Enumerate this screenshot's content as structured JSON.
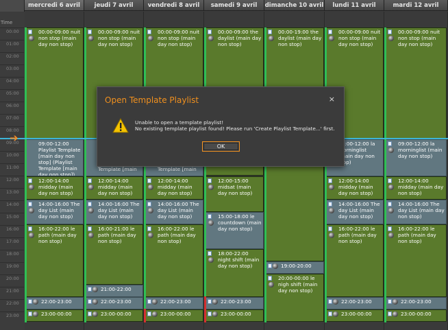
{
  "time_column": {
    "label": "Time",
    "hours": [
      "00:00",
      "01:00",
      "02:00",
      "03:00",
      "04:00",
      "05:00",
      "06:00",
      "07:00",
      "08:00",
      "09:00",
      "10:00",
      "11:00",
      "12:00",
      "13:00",
      "14:00",
      "15:00",
      "16:00",
      "17:00",
      "18:00",
      "19:00",
      "20:00",
      "21:00",
      "22:00",
      "23:00"
    ]
  },
  "days": [
    "mercredi 6 avril",
    "jeudi 7 avril",
    "vendredi 8 avril",
    "samedi 9 avril",
    "dimanche 10 avril",
    "lundi 11 avril",
    "mardi 12 avril"
  ],
  "events": {
    "e0_0": "00:00-09:00 nuit non stop (main day non stop)",
    "e0_1": "09:00-12:00 Playlist Template [main day non stop] (Playlist Template [main day non stop])",
    "e0_2": "12:00-14:00 midday (main day non stop)",
    "e0_3": "14:00-16:00 The day List (main day non stop)",
    "e0_4": "16:00-22:00 le path (main day non stop)",
    "e0_5": "22:00-23:00",
    "e0_6": "23:00-00:00",
    "e1_0": "00:00-09:00 nuit non stop (main day non stop)",
    "e1_1": "Template [main",
    "e1_2": "12:00-14:00 midday (main day non stop)",
    "e1_3": "14:00-16:00 The day List (main day non stop)",
    "e1_4": "16:00-21:00 le path (main day non stop)",
    "e1_5": "21:00-22:00",
    "e1_6": "22:00-23:00",
    "e1_7": "23:00-00:00",
    "e2_0": "00:00-09:00 nuit non stop (main day non stop)",
    "e2_1": "Template [main",
    "e2_2": "12:00-14:00 midday (main day non stop)",
    "e2_3": "14:00-16:00 The day List (main day non stop)",
    "e2_4": "16:00-22:00 le path (main day non stop)",
    "e2_5": "22:00-23:00",
    "e2_6": "23:00-00:00",
    "e3_0": "00:00-09:00 the daylist (main day non stop)",
    "e3_1": "12:00-15:00 midsat (main day non stop)",
    "e3_2": "15:00-18:00 le countdown (main day non stop)",
    "e3_3": "18:00-22:00 night shift (main day non stop)",
    "e3_4": "22:00-23:00",
    "e3_5": "23:00-00:00",
    "e4_0": "00:00-19:00 the daylist (main day non stop)",
    "e4_1": "19:00-20:00",
    "e4_2": "20:00-00:00 le nigh shift (main day non stop)",
    "e5_0": "00:00-09:00 nuit non stop (main day non stop)",
    "e5_1": "09:00-12:00 la morninglist (main day non stop)",
    "e5_2": "12:00-14:00 midday (main day non stop)",
    "e5_3": "14:00-16:00 The day List (main day non stop)",
    "e5_4": "16:00-22:00 le path (main day non stop)",
    "e5_5": "22:00-23:00",
    "e5_6": "23:00-00:00",
    "e6_0": "00:00-09:00 nuit non stop (main day non stop)",
    "e6_1": "09:00-12:00 la morninglist (main day non stop)",
    "e6_2": "12:00-14:00 midday (main day non stop)",
    "e6_3": "14:00-16:00 The day List (main day non stop)",
    "e6_4": "16:00-22:00 le path (main day non stop)",
    "e6_5": "22:00-23:00",
    "e6_6": "23:00-00:00"
  },
  "dialog": {
    "title": "Open Template Playlist",
    "close": "×",
    "icon": "warning-icon",
    "line1": "Unable to open a template playlist!",
    "line2": "No existing template playlist found! Please run 'Create Playlist Template...' first.",
    "ok": "OK"
  },
  "now_marker_icon": "arrow-right-icon",
  "colors": {
    "accent": "#f0901e",
    "event_green": "#5a7a2c",
    "event_blue": "#617780",
    "now_line": "#3db5d8"
  }
}
